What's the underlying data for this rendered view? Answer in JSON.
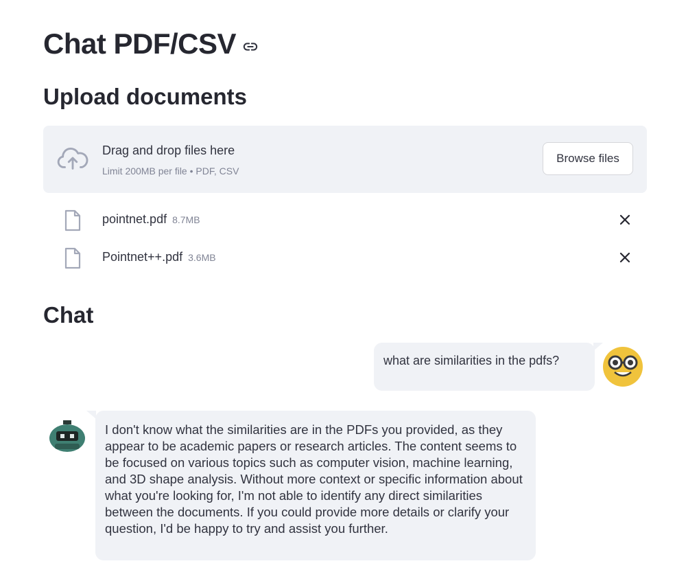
{
  "page": {
    "title": "Chat PDF/CSV",
    "title_link_icon": "link-icon"
  },
  "upload": {
    "heading": "Upload documents",
    "dropzone_title": "Drag and drop files here",
    "dropzone_subtitle": "Limit 200MB per file • PDF, CSV",
    "browse_label": "Browse files",
    "icon": "cloud-upload-icon",
    "files": [
      {
        "name": "pointnet.pdf",
        "size": "8.7MB",
        "icon": "file-icon",
        "remove_icon": "close-icon"
      },
      {
        "name": "Pointnet++.pdf",
        "size": "3.6MB",
        "icon": "file-icon",
        "remove_icon": "close-icon"
      }
    ]
  },
  "chat": {
    "heading": "Chat",
    "messages": [
      {
        "role": "user",
        "avatar": "nerd-face-icon",
        "text": "what are similarities in the pdfs?"
      },
      {
        "role": "assistant",
        "avatar": "robot-icon",
        "text": "I don't know what the similarities are in the PDFs you provided, as they appear to be academic papers or research articles. The content seems to be focused on various topics such as computer vision, machine learning, and 3D shape analysis. Without more context or specific information about what you're looking for, I'm not able to identify any direct similarities between the documents. If you could provide more details or clarify your question, I'd be happy to try and assist you further."
      }
    ]
  },
  "colors": {
    "panel": "#f0f2f6",
    "text": "#31333f",
    "muted": "#808495",
    "user_avatar": "#f0c33c",
    "bot_avatar": "#3f7f72"
  }
}
